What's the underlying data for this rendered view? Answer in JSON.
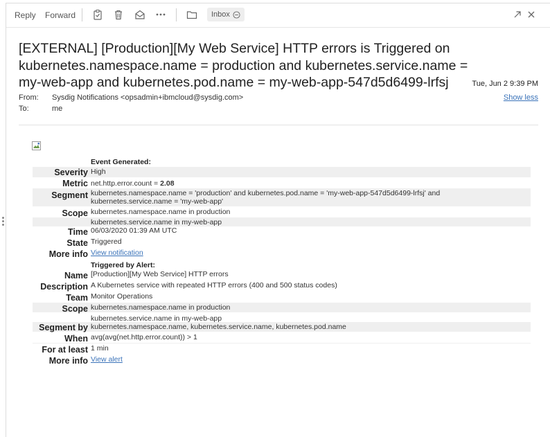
{
  "toolbar": {
    "reply_label": "Reply",
    "forward_label": "Forward",
    "inbox_label": "Inbox",
    "icons": [
      "clipboard-icon",
      "trash-icon",
      "envelope-open-icon",
      "more-icon",
      "folder-icon",
      "popout-icon",
      "close-icon"
    ]
  },
  "email": {
    "subject": "[EXTERNAL] [Production][My Web Service] HTTP errors is Triggered on kubernetes.namespace.name = production and kubernetes.service.name = my-web-app and kubernetes.pod.name = my-web-app-547d5d6499-lrfsj",
    "date": "Tue, Jun 2 9:39 PM",
    "from_label": "From:",
    "from_value": "Sysdig Notifications <opsadmin+ibmcloud@sysdig.com>",
    "to_label": "To:",
    "to_value": "me",
    "show_less": "Show less"
  },
  "event": {
    "event_generated": "Event Generated:",
    "severity_label": "Severity",
    "severity": "High",
    "metric_label": "Metric",
    "metric_prefix": "net.http.error.count = ",
    "metric_value": "2.08",
    "segment_label": "Segment",
    "segment_line1": "kubernetes.namespace.name = 'production' and kubernetes.pod.name = 'my-web-app-547d5d6499-lrfsj' and",
    "segment_line2": "kubernetes.service.name = 'my-web-app'",
    "scope_label": "Scope",
    "scope1": "kubernetes.namespace.name in production",
    "scope2": "kubernetes.service.name in my-web-app",
    "time_label": "Time",
    "time": "06/03/2020 01:39 AM UTC",
    "state_label": "State",
    "state": "Triggered",
    "moreinfo_label": "More info",
    "view_notification": "View notification"
  },
  "alert": {
    "triggered_by": "Triggered by Alert:",
    "name_label": "Name",
    "name": "[Production][My Web Service] HTTP errors",
    "description_label": "Description",
    "description": "A Kubernetes service with repeated HTTP errors (400 and 500 status codes)",
    "team_label": "Team",
    "team": "Monitor Operations",
    "scope_label": "Scope",
    "scope1": "kubernetes.namespace.name in production",
    "scope2": "kubernetes.service.name in my-web-app",
    "segmentby_label": "Segment by",
    "segmentby": "kubernetes.namespace.name, kubernetes.service.name, kubernetes.pod.name",
    "when_label": "When",
    "when": "avg(avg(net.http.error.count)) > 1",
    "foratleast_label": "For at least",
    "foratleast": "1 min",
    "moreinfo_label": "More info",
    "view_alert": "View alert"
  }
}
